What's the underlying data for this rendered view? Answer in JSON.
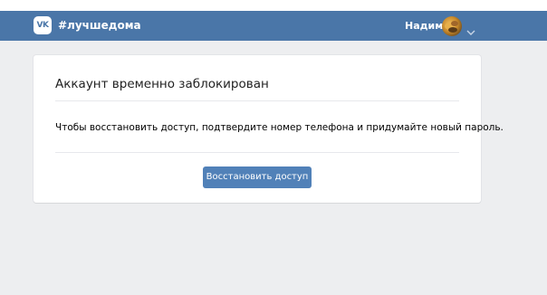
{
  "header": {
    "logo_text": "VK",
    "hashtag": "#лучшедома",
    "user_name": "Надим",
    "background_color": "#4a76a8"
  },
  "card": {
    "title": "Аккаунт временно заблокирован",
    "message": "Чтобы восстановить доступ, подтвердите номер телефона и придумайте новый пароль.",
    "button_label": "Восстановить доступ",
    "button_color": "#5181b8"
  },
  "icons": {
    "logo": "vk-logo-icon",
    "avatar": "user-avatar",
    "menu": "chevron-down-icon"
  }
}
